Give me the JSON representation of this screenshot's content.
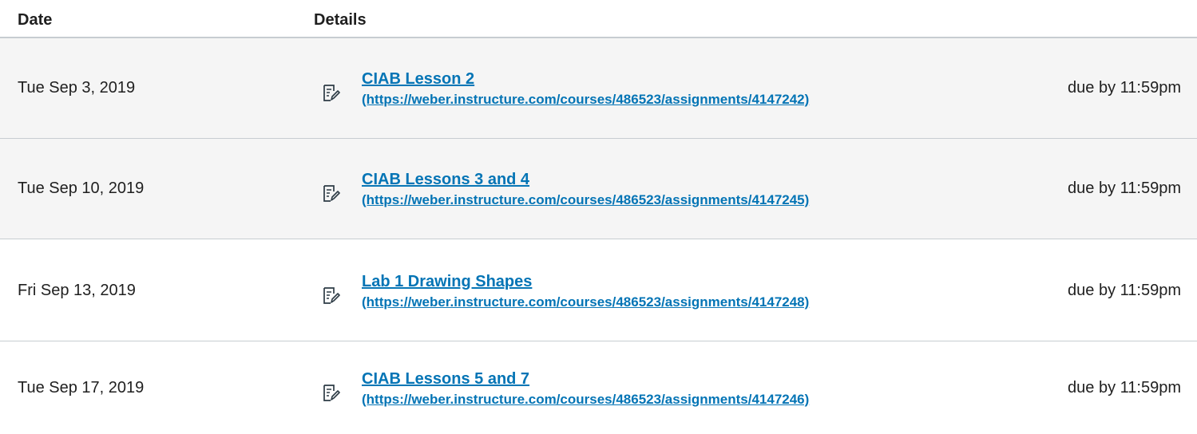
{
  "table": {
    "headers": {
      "date": "Date",
      "details": "Details"
    },
    "rows": [
      {
        "date": "Tue Sep 3, 2019",
        "icon": "assignment-icon",
        "title": "CIAB Lesson 2",
        "url": "(https://weber.instructure.com/courses/486523/assignments/4147242)",
        "due": "due by 11:59pm"
      },
      {
        "date": "Tue Sep 10, 2019",
        "icon": "assignment-icon",
        "title": "CIAB Lessons 3 and 4",
        "url": "(https://weber.instructure.com/courses/486523/assignments/4147245)",
        "due": "due by 11:59pm"
      },
      {
        "date": "Fri Sep 13, 2019",
        "icon": "assignment-icon",
        "title": "Lab 1 Drawing Shapes",
        "url": "(https://weber.instructure.com/courses/486523/assignments/4147248)",
        "due": "due by 11:59pm"
      },
      {
        "date": "Tue Sep 17, 2019",
        "icon": "assignment-icon",
        "title": "CIAB Lessons 5 and 7",
        "url": "(https://weber.instructure.com/courses/486523/assignments/4147246)",
        "due": "due by 11:59pm"
      }
    ]
  },
  "colors": {
    "link": "#0374b5",
    "row_shade": "#f5f5f5",
    "divider": "#c7cdd1"
  }
}
